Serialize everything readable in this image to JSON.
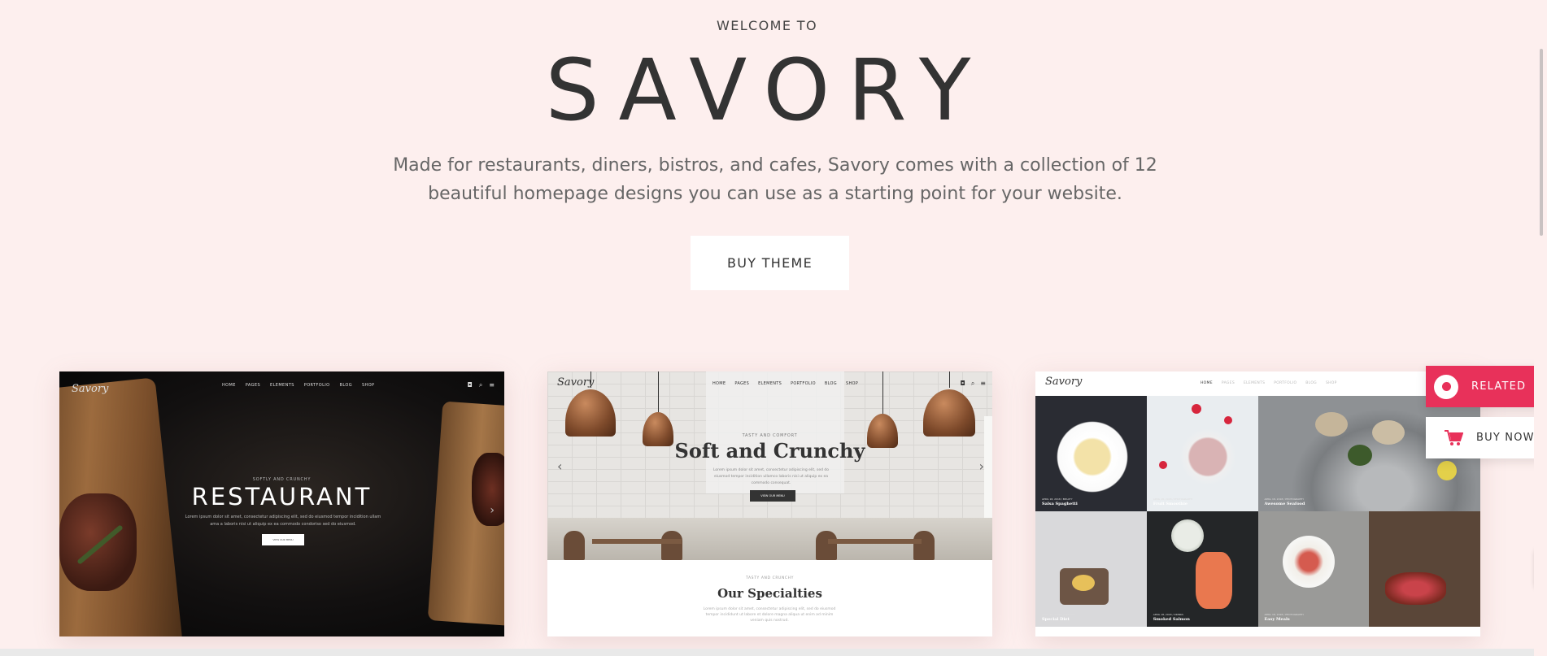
{
  "hero": {
    "welcome": "WELCOME TO",
    "brand": "SAVORY",
    "description": "Made for restaurants, diners, bistros, and cafes, Savory comes with a collection of 12 beautiful homepage designs you can use as a starting point for your website.",
    "buy_button": "BUY THEME"
  },
  "demos": [
    {
      "nav": [
        "HOME",
        "PAGES",
        "ELEMENTS",
        "PORTFOLIO",
        "BLOG",
        "SHOP"
      ],
      "subtitle": "SOFTLY AND CRUNCHY",
      "title": "RESTAURANT",
      "body": "Lorem ipsum dolor sit amet, consectetur adipiscing elit, sed do eiusmod tempor incidition ullam ama a laboris nisi ut aliquip ex ea commodo condoriso sed do eiusmod.",
      "button": "VIEW OUR MENU"
    },
    {
      "nav": [
        "HOME",
        "PAGES",
        "ELEMENTS",
        "PORTFOLIO",
        "BLOG",
        "SHOP"
      ],
      "subtitle": "TASTY AND COMFORT",
      "title": "Soft and Crunchy",
      "body": "Lorem ipsum dolor sit amet, consectetur adipiscing elit, sed do eiusmod tempor incidition ullamco laboris nisi ut aliquip ex ea commodo consequat.",
      "button": "VIEW OUR MENU",
      "section_subtitle": "TASTY AND CRUNCHY",
      "section_title": "Our Specialties",
      "section_body": "Lorem ipsum dolor sit amet, consectetur adipiscing elit, sed do eiusmod tempor incididunt ut labore et dolore magna aliqua ut enim ad minim veniam quis nostrud."
    },
    {
      "nav": [
        "HOME",
        "PAGES",
        "ELEMENTS",
        "PORTFOLIO",
        "BLOG",
        "SHOP"
      ],
      "tiles": [
        {
          "meta": "APRIL 18, 2018 / BEAUTY",
          "caption": "Salsa Spaghetti"
        },
        {
          "meta": "APRIL 18, 2018 / PHOTOGRAPHY",
          "caption": "Fruit Smoothie"
        },
        {
          "meta": "APRIL 18, 2018 / PHOTOGRAPHY",
          "caption": "Awesome Seafood"
        },
        {
          "meta": "APRIL 18, 2018 / LIFESTYLE",
          "caption": "Special Diet"
        },
        {
          "meta": "APRIL 18, 2018 / DRINKS",
          "caption": "Smoked Salmon"
        },
        {
          "meta": "APRIL 18, 2018 / PHOTOGRAPHY",
          "caption": "Easy Meals"
        },
        {
          "meta": "",
          "caption": ""
        }
      ]
    }
  ],
  "side": {
    "related": "RELATED",
    "buy_now": "BUY NOW"
  },
  "colors": {
    "background": "#fdefee",
    "accent": "#e8315a"
  }
}
